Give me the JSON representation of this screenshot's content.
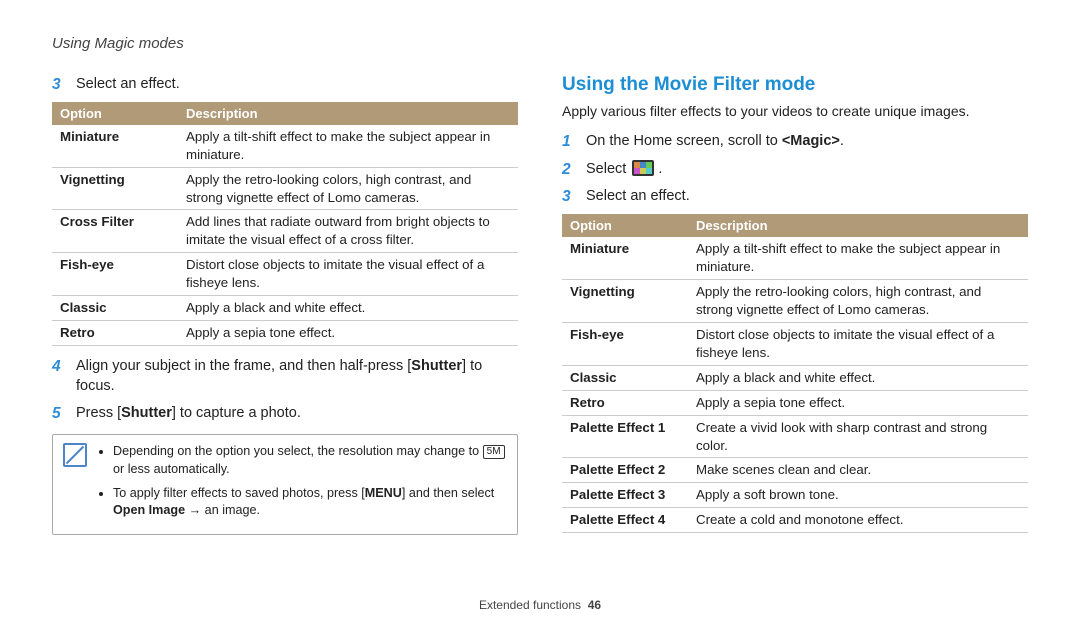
{
  "header": "Using Magic modes",
  "footer": {
    "label": "Extended functions",
    "page": "46"
  },
  "left": {
    "steps": {
      "s3": {
        "num": "3",
        "text": "Select an effect."
      },
      "s4": {
        "num": "4",
        "pre": "Align your subject in the frame, and then half-press [",
        "bold": "Shutter",
        "post": "] to focus."
      },
      "s5": {
        "num": "5",
        "pre": "Press [",
        "bold": "Shutter",
        "post": "] to capture a photo."
      }
    },
    "table": {
      "head_option": "Option",
      "head_desc": "Description",
      "rows": [
        {
          "name": "Miniature",
          "desc": "Apply a tilt-shift effect to make the subject appear in miniature."
        },
        {
          "name": "Vignetting",
          "desc": "Apply the retro-looking colors, high contrast, and strong vignette effect of Lomo cameras."
        },
        {
          "name": "Cross Filter",
          "desc": "Add lines that radiate outward from bright objects to imitate the visual effect of a cross filter."
        },
        {
          "name": "Fish-eye",
          "desc": "Distort close objects to imitate the visual effect of a fisheye lens."
        },
        {
          "name": "Classic",
          "desc": "Apply a black and white effect."
        },
        {
          "name": "Retro",
          "desc": "Apply a sepia tone effect."
        }
      ]
    },
    "note": {
      "b1_pre": "Depending on the option you select, the resolution may change to ",
      "b1_chip": "5M",
      "b1_post": " or less automatically.",
      "b2_pre": "To apply filter effects to saved photos, press [",
      "b2_chip": "MENU",
      "b2_mid": "] and then select ",
      "b2_bold": "Open Image",
      "b2_post": " → an image."
    }
  },
  "right": {
    "title": "Using the Movie Filter mode",
    "intro": "Apply various filter effects to your videos to create unique images.",
    "steps": {
      "s1": {
        "num": "1",
        "pre": "On the Home screen, scroll to ",
        "bold": "<Magic>",
        "post": "."
      },
      "s2": {
        "num": "2",
        "text": "Select "
      },
      "s3": {
        "num": "3",
        "text": "Select an effect."
      }
    },
    "table": {
      "head_option": "Option",
      "head_desc": "Description",
      "rows": [
        {
          "name": "Miniature",
          "desc": "Apply a tilt-shift effect to make the subject appear in miniature."
        },
        {
          "name": "Vignetting",
          "desc": "Apply the retro-looking colors, high contrast, and strong vignette effect of Lomo cameras."
        },
        {
          "name": "Fish-eye",
          "desc": "Distort close objects to imitate the visual effect of a fisheye lens."
        },
        {
          "name": "Classic",
          "desc": "Apply a black and white effect."
        },
        {
          "name": "Retro",
          "desc": "Apply a sepia tone effect."
        },
        {
          "name": "Palette Effect 1",
          "desc": "Create a vivid look with sharp contrast and strong color."
        },
        {
          "name": "Palette Effect 2",
          "desc": "Make scenes clean and clear."
        },
        {
          "name": "Palette Effect 3",
          "desc": "Apply a soft brown tone."
        },
        {
          "name": "Palette Effect 4",
          "desc": "Create a cold and monotone effect."
        }
      ]
    }
  }
}
